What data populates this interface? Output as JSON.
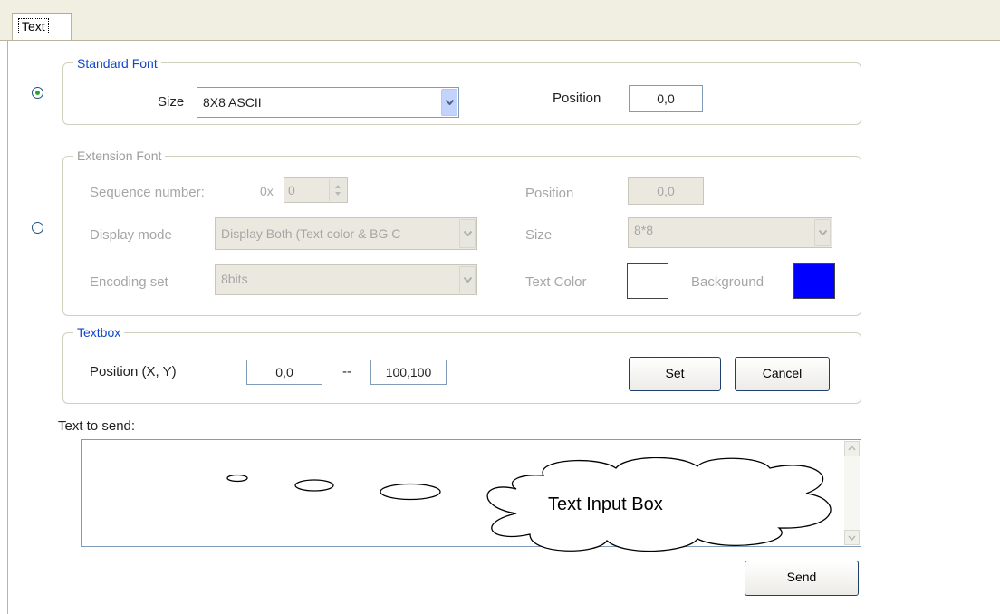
{
  "tab": {
    "label": "Text"
  },
  "standard_font": {
    "legend": "Standard Font",
    "selected": true,
    "size_label": "Size",
    "size_value": "8X8 ASCII",
    "position_label": "Position",
    "position_value": "0,0"
  },
  "extension_font": {
    "legend": "Extension Font",
    "selected": false,
    "sequence_label": "Sequence number:",
    "hex_prefix": "0x",
    "sequence_value": "0",
    "display_mode_label": "Display mode",
    "display_mode_value": "Display Both (Text color & BG C",
    "encoding_label": "Encoding set",
    "encoding_value": "8bits",
    "position_label": "Position",
    "position_value": "0,0",
    "size_label": "Size",
    "size_value": "8*8",
    "text_color_label": "Text Color",
    "text_color": "#ffffff",
    "background_label": "Background",
    "background_color": "#0000ff"
  },
  "textbox": {
    "legend": "Textbox",
    "position_label": "Position (X, Y)",
    "from_value": "0,0",
    "separator": "--",
    "to_value": "100,100",
    "set_label": "Set",
    "cancel_label": "Cancel"
  },
  "send_area": {
    "label": "Text to send:",
    "callout_text": "Text Input Box",
    "send_label": "Send"
  }
}
